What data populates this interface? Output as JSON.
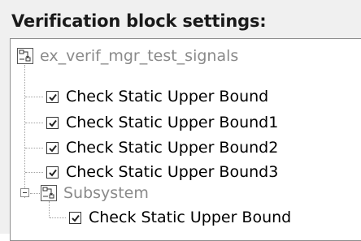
{
  "header": {
    "title": "Verification block settings:"
  },
  "tree": {
    "root": {
      "label": "ex_verif_mgr_test_signals",
      "icon": "model-icon",
      "enabled": false
    },
    "items": [
      {
        "label": "Check Static  Upper Bound",
        "checked": true
      },
      {
        "label": "Check Static  Upper Bound1",
        "checked": true
      },
      {
        "label": "Check Static  Upper Bound2",
        "checked": true
      },
      {
        "label": "Check Static  Upper Bound3",
        "checked": true
      }
    ],
    "subsystem": {
      "label": "Subsystem",
      "icon": "subsystem-icon",
      "expanded": true,
      "enabled": false,
      "items": [
        {
          "label": "Check Static  Upper Bound",
          "checked": true
        }
      ]
    }
  }
}
